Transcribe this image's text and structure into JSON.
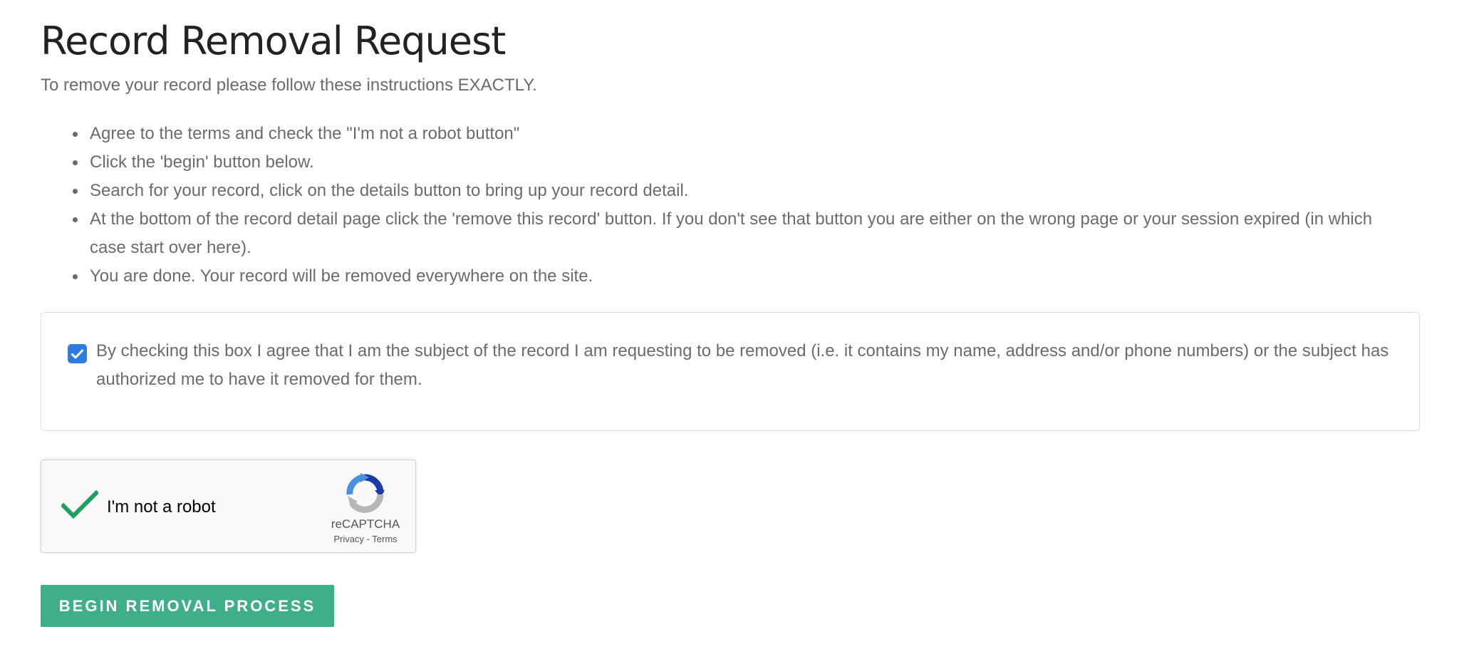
{
  "page": {
    "title": "Record Removal Request",
    "intro": "To remove your record please follow these instructions EXACTLY."
  },
  "steps": [
    "Agree to the terms and check the \"I'm not a robot button\"",
    "Click the 'begin' button below.",
    "Search for your record, click on the details button to bring up your record detail.",
    "At the bottom of the record detail page click the 'remove this record' button. If you don't see that button you are either on the wrong page or your session expired (in which case start over here).",
    "You are done. Your record will be removed everywhere on the site."
  ],
  "terms": {
    "checked": true,
    "text": "By checking this box I agree that I am the subject of the record I am requesting to be removed (i.e. it contains my name, address and/or phone numbers) or the subject has authorized me to have it removed for them."
  },
  "recaptcha": {
    "checked": true,
    "label": "I'm not a robot",
    "brand": "reCAPTCHA",
    "privacy_link": "Privacy",
    "separator": " - ",
    "terms_link": "Terms"
  },
  "actions": {
    "begin_label": "BEGIN REMOVAL PROCESS"
  },
  "colors": {
    "title": "#222222",
    "body_text": "#6b6b6b",
    "checkbox_accent": "#2b7de1",
    "recaptcha_check": "#1fa05a",
    "button_bg": "#3fae8a",
    "button_text": "#ffffff"
  },
  "icons": {
    "terms_checkbox": "checkmark-icon",
    "recaptcha_check": "check-icon",
    "recaptcha_logo": "recaptcha-logo-icon"
  }
}
